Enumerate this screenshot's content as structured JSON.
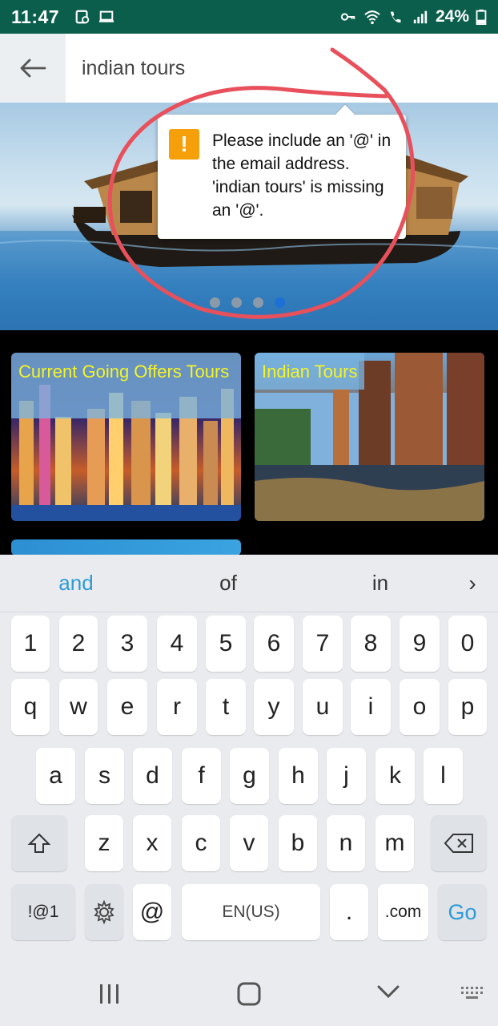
{
  "status_bar": {
    "time": "11:47",
    "battery": "24%",
    "icons": [
      "clipboard-icon",
      "laptop-icon",
      "key-icon",
      "wifi-icon",
      "wifi-call-icon",
      "signal-icon",
      "battery-icon"
    ]
  },
  "search": {
    "value": "indian tours"
  },
  "tooltip": {
    "message": "Please include an '@' in the email address. 'indian tours' is missing an '@'.",
    "icon": "!"
  },
  "banner": {
    "slide_count": 4,
    "active_slide": 4
  },
  "cards": [
    {
      "label": "Current Going Offers Tours"
    },
    {
      "label": "Indian Tours"
    }
  ],
  "keyboard": {
    "suggestions": [
      "and",
      "of",
      "in"
    ],
    "more": "›",
    "row_numbers": [
      "1",
      "2",
      "3",
      "4",
      "5",
      "6",
      "7",
      "8",
      "9",
      "0"
    ],
    "row_1": [
      "q",
      "w",
      "e",
      "r",
      "t",
      "y",
      "u",
      "i",
      "o",
      "p"
    ],
    "row_2": [
      "a",
      "s",
      "d",
      "f",
      "g",
      "h",
      "j",
      "k",
      "l"
    ],
    "row_3": [
      "z",
      "x",
      "c",
      "v",
      "b",
      "n",
      "m"
    ],
    "symbols_key": "!@1",
    "at_key": "@",
    "space_key": "EN(US)",
    "period_key": ".",
    "dotcom_key": ".com",
    "go_key": "Go"
  },
  "colors": {
    "status_bar": "#0b5e4c",
    "accent_blue": "#2e9bd6",
    "card_label_text": "#f4f425",
    "warning": "#f59f0b",
    "annotation_red": "#e8505b"
  }
}
